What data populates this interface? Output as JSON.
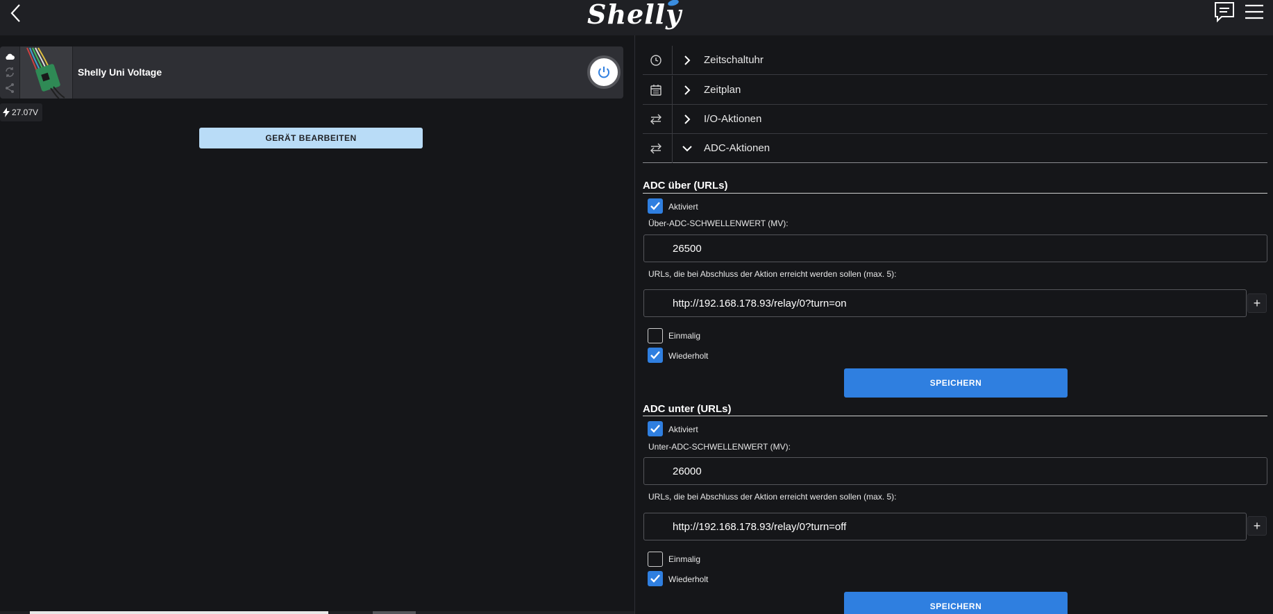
{
  "header": {
    "logo_text": "Shelly",
    "back_icon": "chevron-left-icon",
    "chat_icon": "chat-icon",
    "menu_icon": "hamburger-menu-icon"
  },
  "device": {
    "name": "Shelly Uni Voltage",
    "voltage": "27.07V",
    "edit_label": "GERÄT BEARBEITEN",
    "side_icons": [
      "cloud-icon",
      "sync-icon",
      "share-icon"
    ]
  },
  "accordion": [
    {
      "label": "Zeitschaltuhr",
      "icon": "clock-icon",
      "open": false
    },
    {
      "label": "Zeitplan",
      "icon": "calendar-icon",
      "open": false
    },
    {
      "label": "I/O-Aktionen",
      "icon": "swap-arrows-icon",
      "open": false
    },
    {
      "label": "ADC-Aktionen",
      "icon": "swap-arrows-icon",
      "open": true
    }
  ],
  "adc_over": {
    "title": "ADC über (URLs)",
    "enabled_label": "Aktiviert",
    "enabled": true,
    "threshold_label": "Über-ADC-SCHWELLENWERT (MV):",
    "threshold_value": "26500",
    "urls_label": "URLs, die bei Abschluss der Aktion erreicht werden sollen (max. 5):",
    "url_value": "http://192.168.178.93/relay/0?turn=on",
    "once_label": "Einmalig",
    "once": false,
    "repeat_label": "Wiederholt",
    "repeat": true,
    "save_label": "SPEICHERN"
  },
  "adc_under": {
    "title": "ADC unter (URLs)",
    "enabled_label": "Aktiviert",
    "enabled": true,
    "threshold_label": "Unter-ADC-SCHWELLENWERT (MV):",
    "threshold_value": "26000",
    "urls_label": "URLs, die bei Abschluss der Aktion erreicht werden sollen (max. 5):",
    "url_value": "http://192.168.178.93/relay/0?turn=off",
    "once_label": "Einmalig",
    "once": false,
    "repeat_label": "Wiederholt",
    "repeat": true,
    "save_label": "SPEICHERN"
  },
  "plus_label": "+",
  "colors": {
    "accent": "#2f7fe0",
    "edit_button": "#b9dcf7",
    "background": "#151619",
    "topbar": "#1f2024",
    "card": "#2e2f34"
  }
}
